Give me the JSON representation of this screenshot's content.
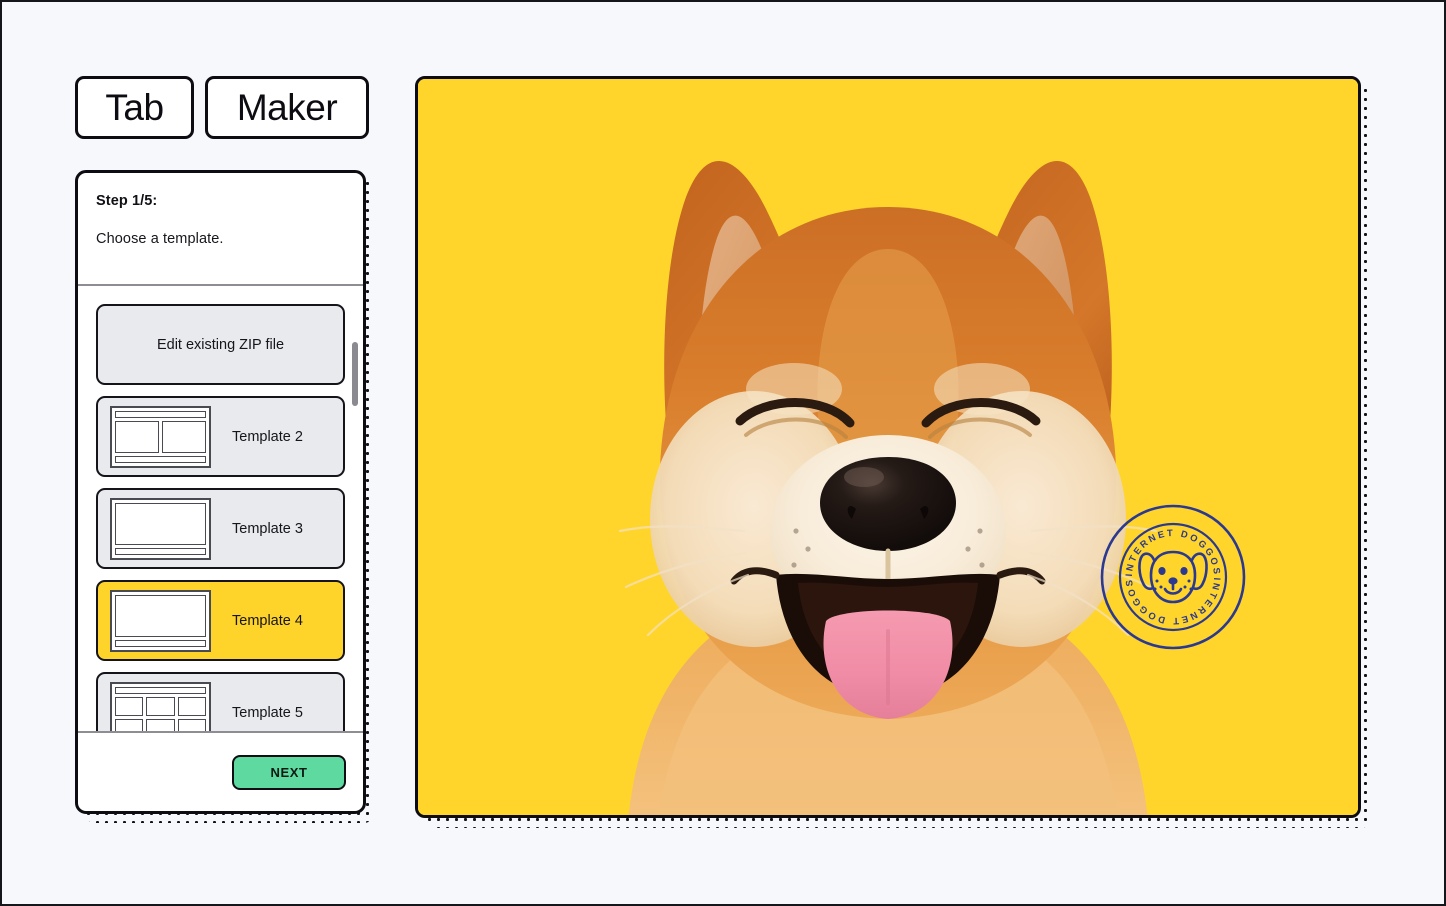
{
  "app": {
    "logo_part_1": "Tab",
    "logo_part_2": "Maker"
  },
  "wizard": {
    "step_label": "Step 1/5:",
    "instruction": "Choose a template.",
    "next_label": "NEXT",
    "templates": [
      {
        "label": "Edit existing ZIP file",
        "thumb": "none",
        "selected": false
      },
      {
        "label": "Template 2",
        "thumb": "two-column",
        "selected": false
      },
      {
        "label": "Template 3",
        "thumb": "single-footer",
        "selected": false
      },
      {
        "label": "Template 4",
        "thumb": "single-footer",
        "selected": true
      },
      {
        "label": "Template 5",
        "thumb": "grid-3x2",
        "selected": false
      }
    ]
  },
  "preview": {
    "background_color": "#FFD52B",
    "subject": "shiba-inu-dog-smiling",
    "badge": {
      "text_top": "INTERNET DOGGOS",
      "text_bottom": "INTERNET DOGGOS",
      "logo": "dog-face-icon",
      "color": "#2B3990"
    }
  },
  "colors": {
    "page_background": "#F7F8FC",
    "outline": "#0C0C12",
    "selected_yellow": "#FFD42A",
    "item_grey": "#E8EAEE",
    "next_green": "#5ED9A0",
    "preview_yellow": "#FFD52B",
    "badge_blue": "#2B3990"
  }
}
